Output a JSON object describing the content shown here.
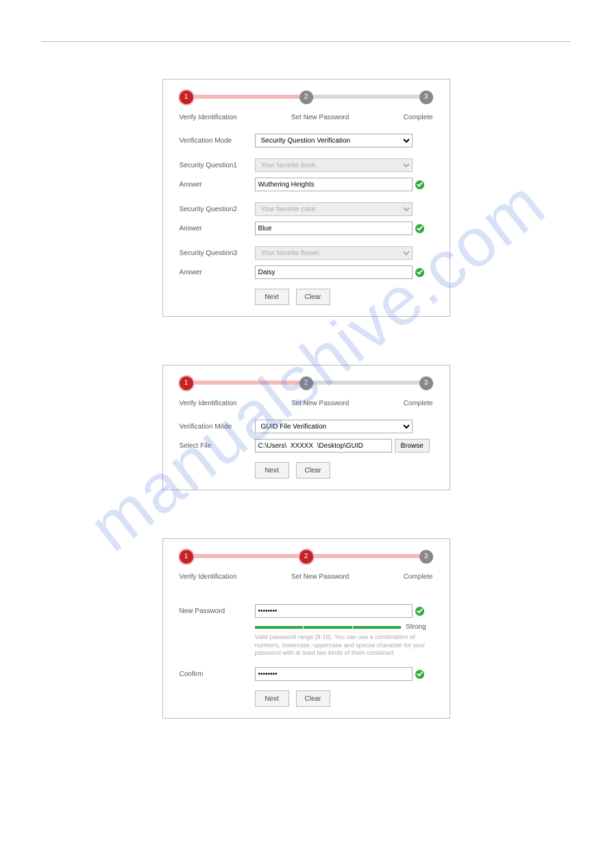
{
  "watermark": "manualshive.com",
  "stepper": {
    "step1": "1",
    "step2": "2",
    "step3": "3",
    "labels": {
      "verify": "Verify Identification",
      "setpw": "Set New Password",
      "complete": "Complete"
    }
  },
  "panel1": {
    "verificationModeLabel": "Verification Mode",
    "verificationModeValue": "Security Question Verification",
    "q1Label": "Security Question1",
    "q1Value": "Your favorite book.",
    "a1Label": "Answer",
    "a1Value": "Wuthering Heights",
    "q2Label": "Security Question2",
    "q2Value": "Your favorite color.",
    "a2Label": "Answer",
    "a2Value": "Blue",
    "q3Label": "Security Question3",
    "q3Value": "Your favorite flower.",
    "a3Label": "Answer",
    "a3Value": "Daisy",
    "nextBtn": "Next",
    "clearBtn": "Clear"
  },
  "panel2": {
    "verificationModeLabel": "Verification Mode",
    "verificationModeValue": "GUID File Verification",
    "selectFileLabel": "Select File",
    "selectFileValue": "C:\\Users\\  XXXXX  \\Desktop\\GUID",
    "browseBtn": "Browse",
    "nextBtn": "Next",
    "clearBtn": "Clear"
  },
  "panel3": {
    "newPasswordLabel": "New Password",
    "newPasswordValue": "••••••••",
    "strengthLabel": "Strong",
    "hint": "Valid password range [8-16]. You can use a combination of numbers, lowercase, uppercase and special character for your password with at least two kinds of them contained.",
    "confirmLabel": "Confirm",
    "confirmValue": "••••••••",
    "nextBtn": "Next",
    "clearBtn": "Clear"
  }
}
